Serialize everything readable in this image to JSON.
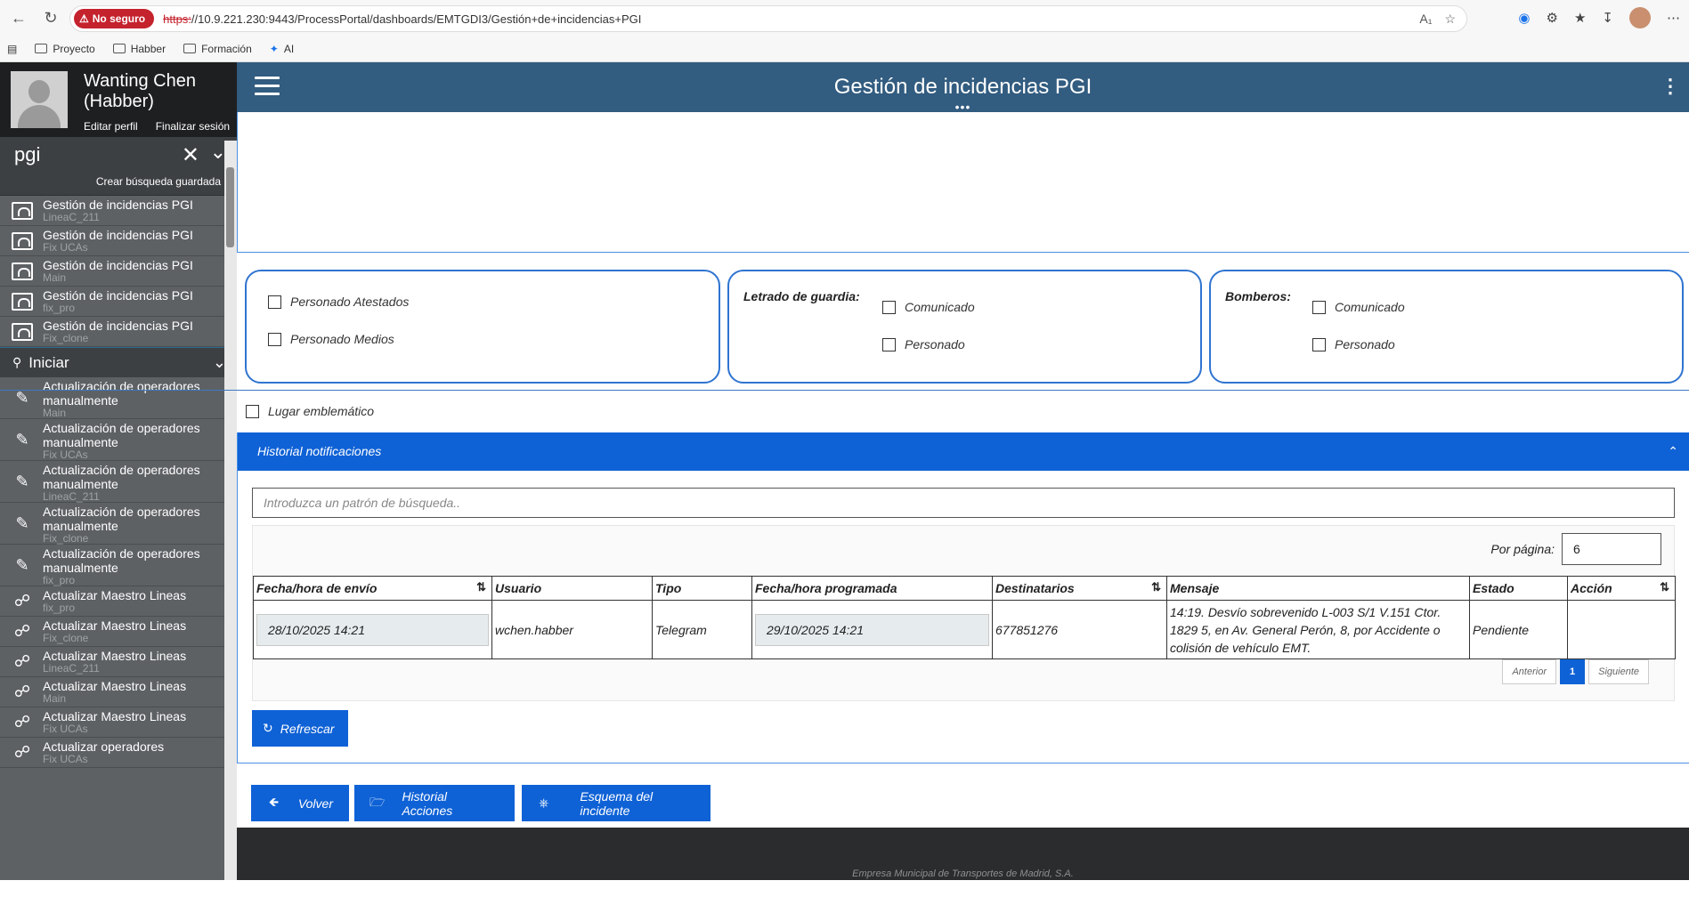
{
  "browser": {
    "not_secure_label": "No seguro",
    "url_scheme": "https:",
    "url_rest": "//10.9.221.230:9443/ProcessPortal/dashboards/EMTGDI3/Gestión+de+incidencias+PGI",
    "bookmarks": [
      "Proyecto",
      "Habber",
      "Formación",
      "AI"
    ]
  },
  "profile": {
    "name": "Wanting Chen (Habber)",
    "edit_label": "Editar perfil",
    "logout_label": "Finalizar sesión"
  },
  "sidebar": {
    "search_value": "pgi",
    "saved_search_label": "Crear búsqueda guardada",
    "dashboards": [
      {
        "title": "Gestión de incidencias PGI",
        "sub": "LineaC_211"
      },
      {
        "title": "Gestión de incidencias PGI",
        "sub": "Fix UCAs"
      },
      {
        "title": "Gestión de incidencias PGI",
        "sub": "Main"
      },
      {
        "title": "Gestión de incidencias PGI",
        "sub": "fix_pro"
      },
      {
        "title": "Gestión de incidencias PGI",
        "sub": "Fix_clone"
      }
    ],
    "start_label": "Iniciar",
    "processes": [
      {
        "title": "Actualización de operadores manualmente",
        "sub": "Main"
      },
      {
        "title": "Actualización de operadores manualmente",
        "sub": "Fix UCAs"
      },
      {
        "title": "Actualización de operadores manualmente",
        "sub": "LineaC_211"
      },
      {
        "title": "Actualización de operadores manualmente",
        "sub": "Fix_clone"
      },
      {
        "title": "Actualización de operadores manualmente",
        "sub": "fix_pro"
      },
      {
        "title": "Actualizar Maestro Lineas",
        "sub": "fix_pro"
      },
      {
        "title": "Actualizar Maestro Lineas",
        "sub": "Fix_clone"
      },
      {
        "title": "Actualizar Maestro Lineas",
        "sub": "LineaC_211"
      },
      {
        "title": "Actualizar Maestro Lineas",
        "sub": "Main"
      },
      {
        "title": "Actualizar Maestro Lineas",
        "sub": "Fix UCAs"
      },
      {
        "title": "Actualizar operadores",
        "sub": "Fix UCAs"
      }
    ]
  },
  "header": {
    "title": "Gestión de incidencias PGI"
  },
  "checks": {
    "personado_atestados": "Personado Atestados",
    "personado_medios": "Personado Medios",
    "letrado_label": "Letrado de guardia:",
    "letrado_comunicado": "Comunicado",
    "letrado_personado": "Personado",
    "bomberos_label": "Bomberos:",
    "bomberos_comunicado": "Comunicado",
    "bomberos_personado": "Personado",
    "lugar": "Lugar emblemático"
  },
  "historial": {
    "title": "Historial notificaciones",
    "search_placeholder": "Introduzca un patrón de búsqueda..",
    "per_page_label": "Por página:",
    "per_page_value": "6",
    "columns": [
      "Fecha/hora de envío",
      "Usuario",
      "Tipo",
      "Fecha/hora programada",
      "Destinatarios",
      "Mensaje",
      "Estado",
      "Acción"
    ],
    "row": {
      "fecha_envio": "28/10/2025 14:21",
      "usuario": "wchen.habber",
      "tipo": "Telegram",
      "fecha_programada": "29/10/2025 14:21",
      "destinatarios": "677851276",
      "mensaje": "14:19. Desvío sobrevenido L-003 S/1 V.151 Ctor. 1829 5, en Av. General Perón, 8, por Accidente o colisión de vehículo EMT.",
      "estado": "Pendiente",
      "accion": ""
    },
    "prev_label": "Anterior",
    "page": "1",
    "next_label": "Siguiente",
    "refresh_label": "Refrescar"
  },
  "actions": {
    "back_label": "Volver",
    "history_label": "Historial Acciones",
    "scheme_label": "Esquema del incidente"
  },
  "footer": {
    "text": "Empresa Municipal de Transportes de Madrid, S.A."
  }
}
